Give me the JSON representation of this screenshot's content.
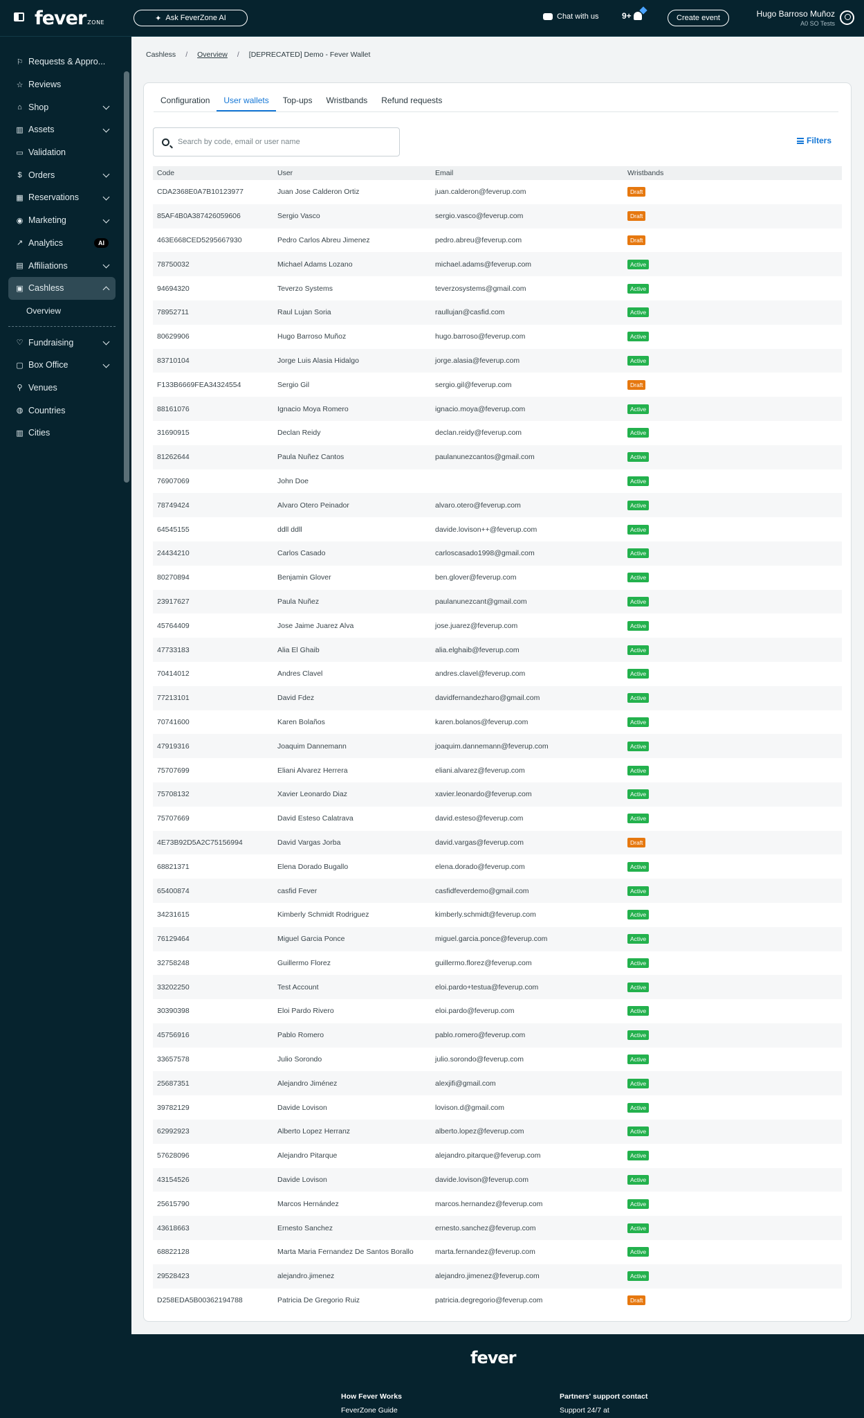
{
  "topbar": {
    "logo": "fever",
    "logo_sub": "ZONE",
    "ask_ai": "Ask FeverZone AI",
    "chat": "Chat with us",
    "notifications": "9+",
    "create_event": "Create event",
    "user_name": "Hugo Barroso Muñoz",
    "user_org": "A0 SO Tests"
  },
  "sidebar": {
    "items": [
      {
        "label": "Requests & Appro...",
        "icon": "flag-icon",
        "glyph": "⚐",
        "chevron": false
      },
      {
        "label": "Reviews",
        "icon": "star-icon",
        "glyph": "☆",
        "chevron": false
      },
      {
        "label": "Shop",
        "icon": "bag-icon",
        "glyph": "⌂",
        "chevron": true
      },
      {
        "label": "Assets",
        "icon": "bank-icon",
        "glyph": "▥",
        "chevron": true
      },
      {
        "label": "Validation",
        "icon": "ticket-icon",
        "glyph": "▭",
        "chevron": false
      },
      {
        "label": "Orders",
        "icon": "dollar-icon",
        "glyph": "$",
        "chevron": true
      },
      {
        "label": "Reservations",
        "icon": "calendar-icon",
        "glyph": "▦",
        "chevron": true
      },
      {
        "label": "Marketing",
        "icon": "coin-icon",
        "glyph": "◉",
        "chevron": true
      },
      {
        "label": "Analytics",
        "icon": "trend-icon",
        "glyph": "↗",
        "chevron": false,
        "badge": "AI"
      },
      {
        "label": "Affiliations",
        "icon": "building-icon",
        "glyph": "▤",
        "chevron": true
      },
      {
        "label": "Cashless",
        "icon": "wallet-icon",
        "glyph": "▣",
        "chevron": true,
        "active": true
      },
      {
        "label": "Overview",
        "sub": true
      },
      {
        "label": "Fundraising",
        "icon": "heart-icon",
        "glyph": "♡",
        "chevron": true
      },
      {
        "label": "Box Office",
        "icon": "box-icon",
        "glyph": "▢",
        "chevron": true
      },
      {
        "label": "Venues",
        "icon": "pin-icon",
        "glyph": "⚲",
        "chevron": false
      },
      {
        "label": "Countries",
        "icon": "globe-icon",
        "glyph": "◍",
        "chevron": false
      },
      {
        "label": "Cities",
        "icon": "city-icon",
        "glyph": "▥",
        "chevron": false
      }
    ]
  },
  "breadcrumb": [
    "Cashless",
    "Overview",
    "[DEPRECATED] Demo - Fever Wallet"
  ],
  "tabs": [
    "Configuration",
    "User wallets",
    "Top-ups",
    "Wristbands",
    "Refund requests"
  ],
  "active_tab": "User wallets",
  "search": {
    "placeholder": "Search by code, email or user name",
    "value": ""
  },
  "filters_label": "Filters",
  "table": {
    "columns": [
      "Code",
      "User",
      "Email",
      "Wristbands"
    ],
    "rows": [
      [
        "CDA2368E0A7B10123977",
        "Juan Jose Calderon Ortiz",
        "juan.calderon@feverup.com",
        "Draft"
      ],
      [
        "85AF4B0A387426059606",
        "Sergio Vasco",
        "sergio.vasco@feverup.com",
        "Draft"
      ],
      [
        "463E668CED5295667930",
        "Pedro Carlos Abreu Jimenez",
        "pedro.abreu@feverup.com",
        "Draft"
      ],
      [
        "78750032",
        "Michael Adams Lozano",
        "michael.adams@feverup.com",
        "Active"
      ],
      [
        "94694320",
        "Teverzo Systems",
        "teverzosystems@gmail.com",
        "Active"
      ],
      [
        "78952711",
        "Raul Lujan Soria",
        "raullujan@casfid.com",
        "Active"
      ],
      [
        "80629906",
        "Hugo Barroso Muñoz",
        "hugo.barroso@feverup.com",
        "Active"
      ],
      [
        "83710104",
        "Jorge Luis Alasia Hidalgo",
        "jorge.alasia@feverup.com",
        "Active"
      ],
      [
        "F133B6669FEA34324554",
        "Sergio Gil",
        "sergio.gil@feverup.com",
        "Draft"
      ],
      [
        "88161076",
        "Ignacio Moya Romero",
        "ignacio.moya@feverup.com",
        "Active"
      ],
      [
        "31690915",
        "Declan Reidy",
        "declan.reidy@feverup.com",
        "Active"
      ],
      [
        "81262644",
        "Paula Nuñez Cantos",
        "paulanunezcantos@gmail.com",
        "Active"
      ],
      [
        "76907069",
        "John Doe",
        "",
        "Active"
      ],
      [
        "78749424",
        "Alvaro Otero Peinador",
        "alvaro.otero@feverup.com",
        "Active"
      ],
      [
        "64545155",
        "ddll ddll",
        "davide.lovison++@feverup.com",
        "Active"
      ],
      [
        "24434210",
        "Carlos Casado",
        "carloscasado1998@gmail.com",
        "Active"
      ],
      [
        "80270894",
        "Benjamin Glover",
        "ben.glover@feverup.com",
        "Active"
      ],
      [
        "23917627",
        "Paula Nuñez",
        "paulanunezcant@gmail.com",
        "Active"
      ],
      [
        "45764409",
        "Jose Jaime Juarez Alva",
        "jose.juarez@feverup.com",
        "Active"
      ],
      [
        "47733183",
        "Alia El Ghaib",
        "alia.elghaib@feverup.com",
        "Active"
      ],
      [
        "70414012",
        "Andres Clavel",
        "andres.clavel@feverup.com",
        "Active"
      ],
      [
        "77213101",
        "David Fdez",
        "davidfernandezharo@gmail.com",
        "Active"
      ],
      [
        "70741600",
        "Karen Bolaños",
        "karen.bolanos@feverup.com",
        "Active"
      ],
      [
        "47919316",
        "Joaquim Dannemann",
        "joaquim.dannemann@feverup.com",
        "Active"
      ],
      [
        "75707699",
        "Eliani Alvarez Herrera",
        "eliani.alvarez@feverup.com",
        "Active"
      ],
      [
        "75708132",
        "Xavier Leonardo Diaz",
        "xavier.leonardo@feverup.com",
        "Active"
      ],
      [
        "75707669",
        "David Esteso Calatrava",
        "david.esteso@feverup.com",
        "Active"
      ],
      [
        "4E73B92D5A2C75156994",
        "David Vargas Jorba",
        "david.vargas@feverup.com",
        "Draft"
      ],
      [
        "68821371",
        "Elena Dorado Bugallo",
        "elena.dorado@feverup.com",
        "Active"
      ],
      [
        "65400874",
        "casfid Fever",
        "casfidfeverdemo@gmail.com",
        "Active"
      ],
      [
        "34231615",
        "Kimberly Schmidt Rodriguez",
        "kimberly.schmidt@feverup.com",
        "Active"
      ],
      [
        "76129464",
        "Miguel Garcia Ponce",
        "miguel.garcia.ponce@feverup.com",
        "Active"
      ],
      [
        "32758248",
        "Guillermo Florez",
        "guillermo.florez@feverup.com",
        "Active"
      ],
      [
        "33202250",
        "Test Account",
        "eloi.pardo+testua@feverup.com",
        "Active"
      ],
      [
        "30390398",
        "Eloi Pardo Rivero",
        "eloi.pardo@feverup.com",
        "Active"
      ],
      [
        "45756916",
        "Pablo Romero",
        "pablo.romero@feverup.com",
        "Active"
      ],
      [
        "33657578",
        "Julio Sorondo",
        "julio.sorondo@feverup.com",
        "Active"
      ],
      [
        "25687351",
        "Alejandro Jiménez",
        "alexjifi@gmail.com",
        "Active"
      ],
      [
        "39782129",
        "Davide Lovison",
        "lovison.d@gmail.com",
        "Active"
      ],
      [
        "62992923",
        "Alberto Lopez Herranz",
        "alberto.lopez@feverup.com",
        "Active"
      ],
      [
        "57628096",
        "Alejandro Pitarque",
        "alejandro.pitarque@feverup.com",
        "Active"
      ],
      [
        "43154526",
        "Davide Lovison",
        "davide.lovison@feverup.com",
        "Active"
      ],
      [
        "25615790",
        "Marcos Hernández",
        "marcos.hernandez@feverup.com",
        "Active"
      ],
      [
        "43618663",
        "Ernesto Sanchez",
        "ernesto.sanchez@feverup.com",
        "Active"
      ],
      [
        "68822128",
        "Marta Maria Fernandez De Santos Borallo",
        "marta.fernandez@feverup.com",
        "Active"
      ],
      [
        "29528423",
        "alejandro.jimenez",
        "alejandro.jimenez@feverup.com",
        "Active"
      ],
      [
        "D258EDA5B00362194788",
        "Patricia De Gregorio Ruiz",
        "patricia.degregorio@feverup.com",
        "Draft"
      ]
    ]
  },
  "footer": {
    "logo": "fever",
    "how_title": "How Fever Works",
    "how_link": "FeverZone Guide",
    "support_title": "Partners' support contact",
    "support_text": "Support 24/7 at"
  }
}
